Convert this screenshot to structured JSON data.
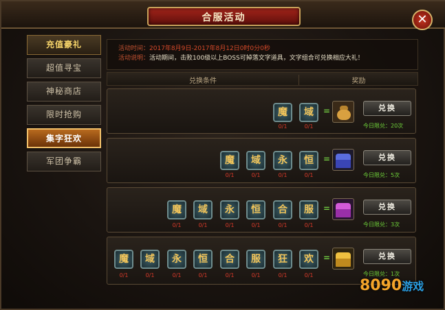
{
  "window": {
    "title": "合服活动",
    "close_symbol": "✕"
  },
  "sidebar": {
    "items": [
      {
        "label": "充值豪礼"
      },
      {
        "label": "超值寻宝"
      },
      {
        "label": "神秘商店"
      },
      {
        "label": "限时抢购"
      },
      {
        "label": "集字狂欢"
      },
      {
        "label": "军团争霸"
      }
    ]
  },
  "info": {
    "time_label": "活动时间：",
    "time_value": "2017年8月9日-2017年8月12日0时0分0秒",
    "desc_label": "活动说明：",
    "desc_value": "活动期间，击败100级以上BOSS可掉落文字道具，文字组合可兑换相应大礼！"
  },
  "table": {
    "col_condition": "兑换条件",
    "col_reward": "奖励",
    "equals": "=",
    "rows": [
      {
        "chars": [
          "魔",
          "域"
        ],
        "counts": [
          "0/1",
          "0/1"
        ],
        "reward_icon": "money-bag-icon",
        "button": "兑换",
        "limit": "今日限兑：20次"
      },
      {
        "chars": [
          "魔",
          "域",
          "永",
          "恒"
        ],
        "counts": [
          "0/1",
          "0/1",
          "0/1",
          "0/1"
        ],
        "reward_icon": "blue-chest-icon",
        "button": "兑换",
        "limit": "今日限兑：5次"
      },
      {
        "chars": [
          "魔",
          "域",
          "永",
          "恒",
          "合",
          "服"
        ],
        "counts": [
          "0/1",
          "0/1",
          "0/1",
          "0/1",
          "0/1",
          "0/1"
        ],
        "reward_icon": "purple-chest-icon",
        "button": "兑换",
        "limit": "今日限兑：3次"
      },
      {
        "chars": [
          "魔",
          "域",
          "永",
          "恒",
          "合",
          "服",
          "狂",
          "欢"
        ],
        "counts": [
          "0/1",
          "0/1",
          "0/1",
          "0/1",
          "0/1",
          "0/1",
          "0/1",
          "0/1"
        ],
        "reward_icon": "gold-chest-icon",
        "button": "兑换",
        "limit": "今日限兑：1次"
      }
    ]
  },
  "watermark": {
    "brand": "8090",
    "suffix": "游戏"
  },
  "colors": {
    "accent": "#f1c06a",
    "count_red": "#d93a2a",
    "limit_green": "#6fd23a"
  }
}
